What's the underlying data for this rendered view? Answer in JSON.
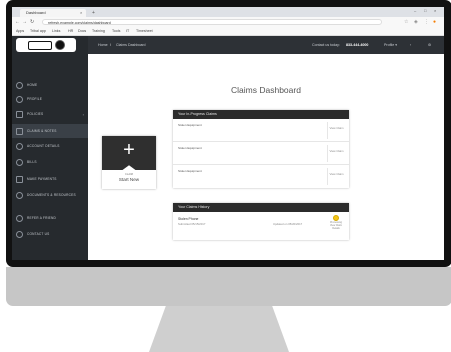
{
  "browser": {
    "tab_title": "Dashboard",
    "tab_close": "×",
    "new_tab": "+",
    "window_controls": [
      "–",
      "□",
      "×"
    ],
    "url": "refresh.example.com/claims/dashboard",
    "bookmarks": [
      "Apps",
      "Tribal app",
      "Links",
      "HR",
      "Docs",
      "Training",
      "Tools",
      "IT",
      "Timesheet"
    ]
  },
  "app": {
    "breadcrumb_home": "Home",
    "breadcrumb_sep": "/",
    "breadcrumb_current": "Claims Dashboard",
    "contact_prefix": "Contact us today:",
    "contact_phone": "833-444-4000",
    "user_label": "Profile",
    "user_caret": "▾",
    "notification_icon": "bell-icon",
    "settings_icon": "gear-icon"
  },
  "sidebar": {
    "items": [
      {
        "label": "Home",
        "icon": "home-icon"
      },
      {
        "label": "Profile",
        "icon": "user-icon"
      },
      {
        "label": "Policies",
        "icon": "document-icon",
        "caret": "›"
      },
      {
        "label": "Claims & Notes",
        "icon": "clipboard-icon",
        "active": true
      },
      {
        "label": "Account Details",
        "icon": "info-icon"
      },
      {
        "label": "Bills",
        "icon": "dollar-icon"
      },
      {
        "label": "Make Payments",
        "icon": "card-icon"
      },
      {
        "label": "Documents & Resources",
        "icon": "folder-icon"
      },
      {
        "label": "Refer a Friend",
        "icon": "people-icon"
      },
      {
        "label": "Contact Us",
        "icon": "phone-icon"
      }
    ]
  },
  "main": {
    "title": "Claims Dashboard",
    "start_card": {
      "plus": "+",
      "sub": "Claim",
      "label": "Start New"
    },
    "in_progress": {
      "header": "Your In-Progress Claims",
      "rows": [
        {
          "desc": "Stolen Equipment",
          "action": "View Claim"
        },
        {
          "desc": "Stolen Equipment",
          "action": "View Claim"
        },
        {
          "desc": "Stolen Equipment",
          "action": "View Claim"
        }
      ]
    },
    "history": {
      "header": "Your Claims History",
      "rows": [
        {
          "title": "Stolen Phone",
          "sub": "Submitted 05/15/2017",
          "updated": "Updated on 05/20/2017",
          "status": "Processing",
          "action": "View Claim",
          "extra": "Details"
        }
      ]
    }
  },
  "colors": {
    "sidebar": "#262a2e",
    "topbar": "#2d3136",
    "panel_header": "#2b2b2b",
    "status_pending": "#f5c518"
  }
}
